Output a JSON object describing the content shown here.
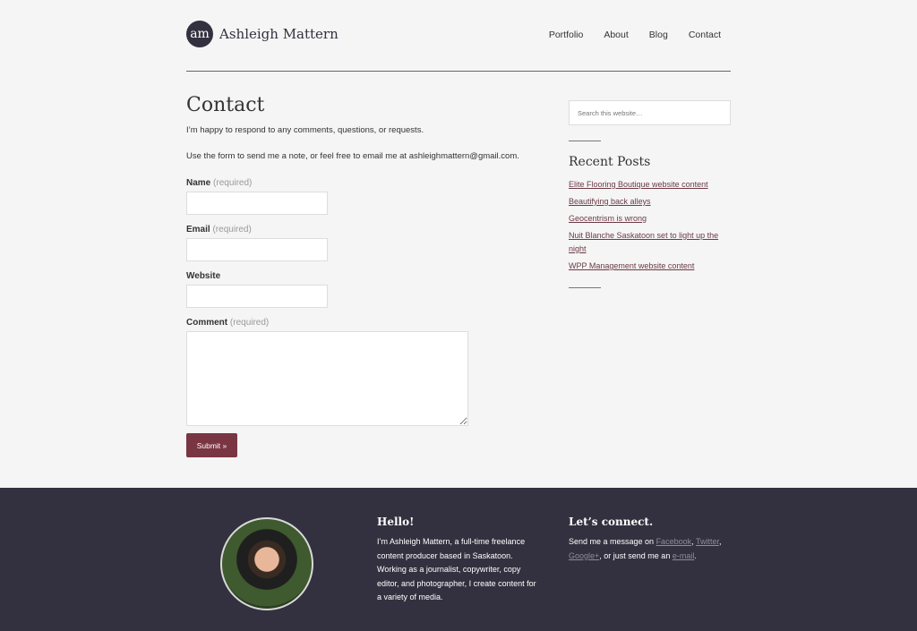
{
  "header": {
    "logo_mark": "am",
    "site_name": "Ashleigh Mattern",
    "nav": [
      "Portfolio",
      "About",
      "Blog",
      "Contact"
    ]
  },
  "main": {
    "title": "Contact",
    "intro": "I’m happy to respond to any comments, questions, or requests.",
    "intro2": "Use the form to send me a note, or feel free to email me at ashleighmattern@gmail.com.",
    "fields": {
      "name": {
        "label": "Name",
        "required": "(required)",
        "value": ""
      },
      "email": {
        "label": "Email",
        "required": "(required)",
        "value": ""
      },
      "website": {
        "label": "Website",
        "value": ""
      },
      "comment": {
        "label": "Comment",
        "required": "(required)",
        "value": ""
      }
    },
    "submit_label": "Submit »"
  },
  "sidebar": {
    "search_placeholder": "Search this website…",
    "recent_title": "Recent Posts",
    "recent_posts": [
      "Elite Flooring Boutique website content",
      "Beautifying back alleys",
      "Geocentrism is wrong",
      "Nuit Blanche Saskatoon set to light up the night",
      "WPP Management website content"
    ]
  },
  "footer": {
    "hello_title": "Hello!",
    "hello_text": "I’m Ashleigh Mattern, a full-time freelance content producer based in Saskatoon. Working as a journalist, copywriter, copy editor, and photographer, I create content for a variety of media.",
    "connect_title": "Let’s connect.",
    "connect_prefix": "Send me a message on ",
    "facebook": "Facebook",
    "twitter": "Twitter",
    "googleplus": "Google+",
    "connect_middle": ", or just send me an ",
    "email": "e-mail",
    "connect_suffix": "."
  },
  "colors": {
    "accent": "#7a3543",
    "dark": "#33313f",
    "link": "#6b3a45",
    "background": "#f5f5f5"
  }
}
